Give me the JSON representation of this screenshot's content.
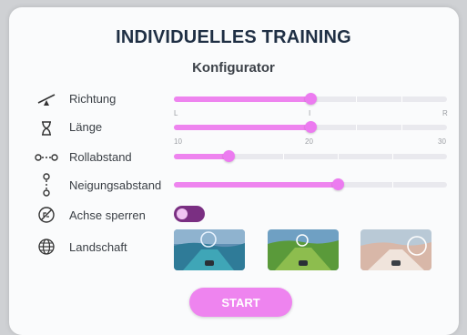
{
  "title": "INDIVIDUELLES TRAINING",
  "subtitle": "Konfigurator",
  "colors": {
    "accent": "#ee84ef",
    "toggle": "#7a2f82",
    "title": "#1f2f44"
  },
  "rows": {
    "richtung": {
      "label": "Richtung",
      "icon": "seesaw-icon",
      "value": 0.5,
      "ticks": [
        "L",
        "I",
        "R"
      ]
    },
    "laenge": {
      "label": "Länge",
      "icon": "hourglass-icon",
      "value": 20,
      "min": 10,
      "max": 30,
      "ticks": [
        "10",
        "20",
        "30"
      ]
    },
    "rollabstand": {
      "label": "Rollabstand",
      "icon": "horizontal-spacing-icon",
      "value": 0.2
    },
    "neigungsabstand": {
      "label": "Neigungsabstand",
      "icon": "vertical-spacing-icon",
      "value": 0.6
    },
    "achse": {
      "label": "Achse sperren",
      "icon": "lock-axis-icon",
      "on": false
    },
    "landschaft": {
      "label": "Landschaft",
      "icon": "globe-icon",
      "options": [
        "landscape-ocean",
        "landscape-green",
        "landscape-desert"
      ]
    }
  },
  "start_label": "START"
}
